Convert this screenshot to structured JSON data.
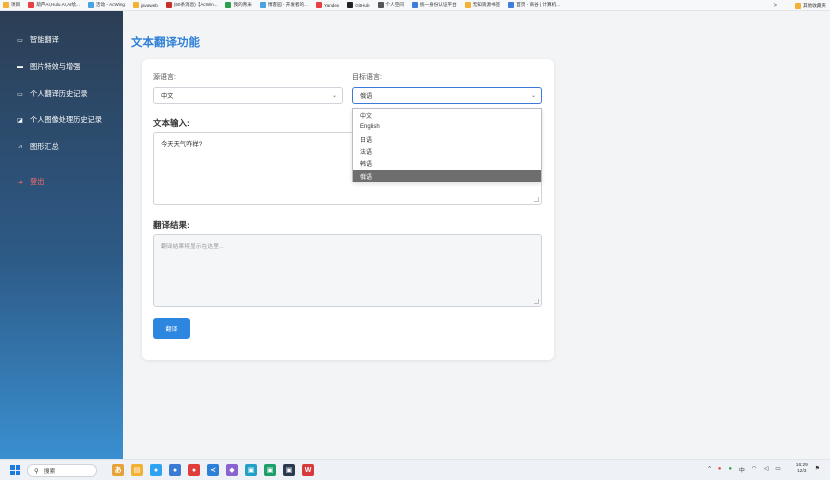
{
  "bookmarks": [
    {
      "label": "项目",
      "color": "#f2b233"
    },
    {
      "label": "葫芦AI,Hulu AI,AI绘...",
      "color": "#e84040"
    },
    {
      "label": "活动 - AcWing",
      "color": "#4aa3df"
    },
    {
      "label": "javaweb",
      "color": "#f2b233"
    },
    {
      "label": "(60条消息)【AcWin...",
      "color": "#c8302b"
    },
    {
      "label": "我的青米",
      "color": "#2aa04a"
    },
    {
      "label": "博客园 - 开发者的...",
      "color": "#4aa3df"
    },
    {
      "label": "Yandex",
      "color": "#e84040"
    },
    {
      "label": "GitHub",
      "color": "#222222"
    },
    {
      "label": "个人空间",
      "color": "#555555"
    },
    {
      "label": "统一身份认证平台",
      "color": "#3d7fd9"
    },
    {
      "label": "无知资源书签",
      "color": "#f2b233"
    },
    {
      "label": "首页 - 商谷 | 计算机...",
      "color": "#3d7fd9"
    }
  ],
  "bookmarks_right": {
    "chevron": ">",
    "other": "其他收藏夹"
  },
  "sidebar": {
    "items": [
      {
        "label": "智能翻译",
        "icon": "▭"
      },
      {
        "label": "图片特效与增强",
        "icon": "▬"
      },
      {
        "label": "个人翻译历史记录",
        "icon": "▭"
      },
      {
        "label": "个人图像处理历史记录",
        "icon": "◪"
      },
      {
        "label": "图形汇总",
        "icon": "⩘"
      }
    ],
    "logout": {
      "label": "登出",
      "icon": "⇥"
    }
  },
  "page_title": "文本翻译功能",
  "form": {
    "source_label": "源语言:",
    "source_value": "中文",
    "target_label": "目标语言:",
    "target_value": "俄语",
    "target_options": [
      "中文",
      "English",
      "日语",
      "法语",
      "韩语",
      "俄语"
    ],
    "input_title": "文本输入:",
    "input_value": "今天天气咋样?",
    "result_title": "翻译结果:",
    "result_placeholder": "翻译结果将显示在这里...",
    "translate_button": "翻译"
  },
  "taskbar": {
    "search_label": "搜索",
    "apps": [
      {
        "glyph": "あ",
        "color": "#e8a23a"
      },
      {
        "glyph": "▤",
        "color": "#f2b233"
      },
      {
        "glyph": "●",
        "color": "#2ea3f2"
      },
      {
        "glyph": "●",
        "color": "#3a7bd5"
      },
      {
        "glyph": "●",
        "color": "#e03c3c"
      },
      {
        "glyph": "≺",
        "color": "#2d7fd8"
      },
      {
        "glyph": "◆",
        "color": "#8a63d2"
      },
      {
        "glyph": "▣",
        "color": "#22a0c8"
      },
      {
        "glyph": "▣",
        "color": "#1e9e6a"
      },
      {
        "glyph": "▣",
        "color": "#2b3a4f"
      },
      {
        "glyph": "W",
        "color": "#d63a3a"
      }
    ],
    "tray": [
      "^",
      "中"
    ],
    "time": "16:29",
    "date": "12/3"
  }
}
